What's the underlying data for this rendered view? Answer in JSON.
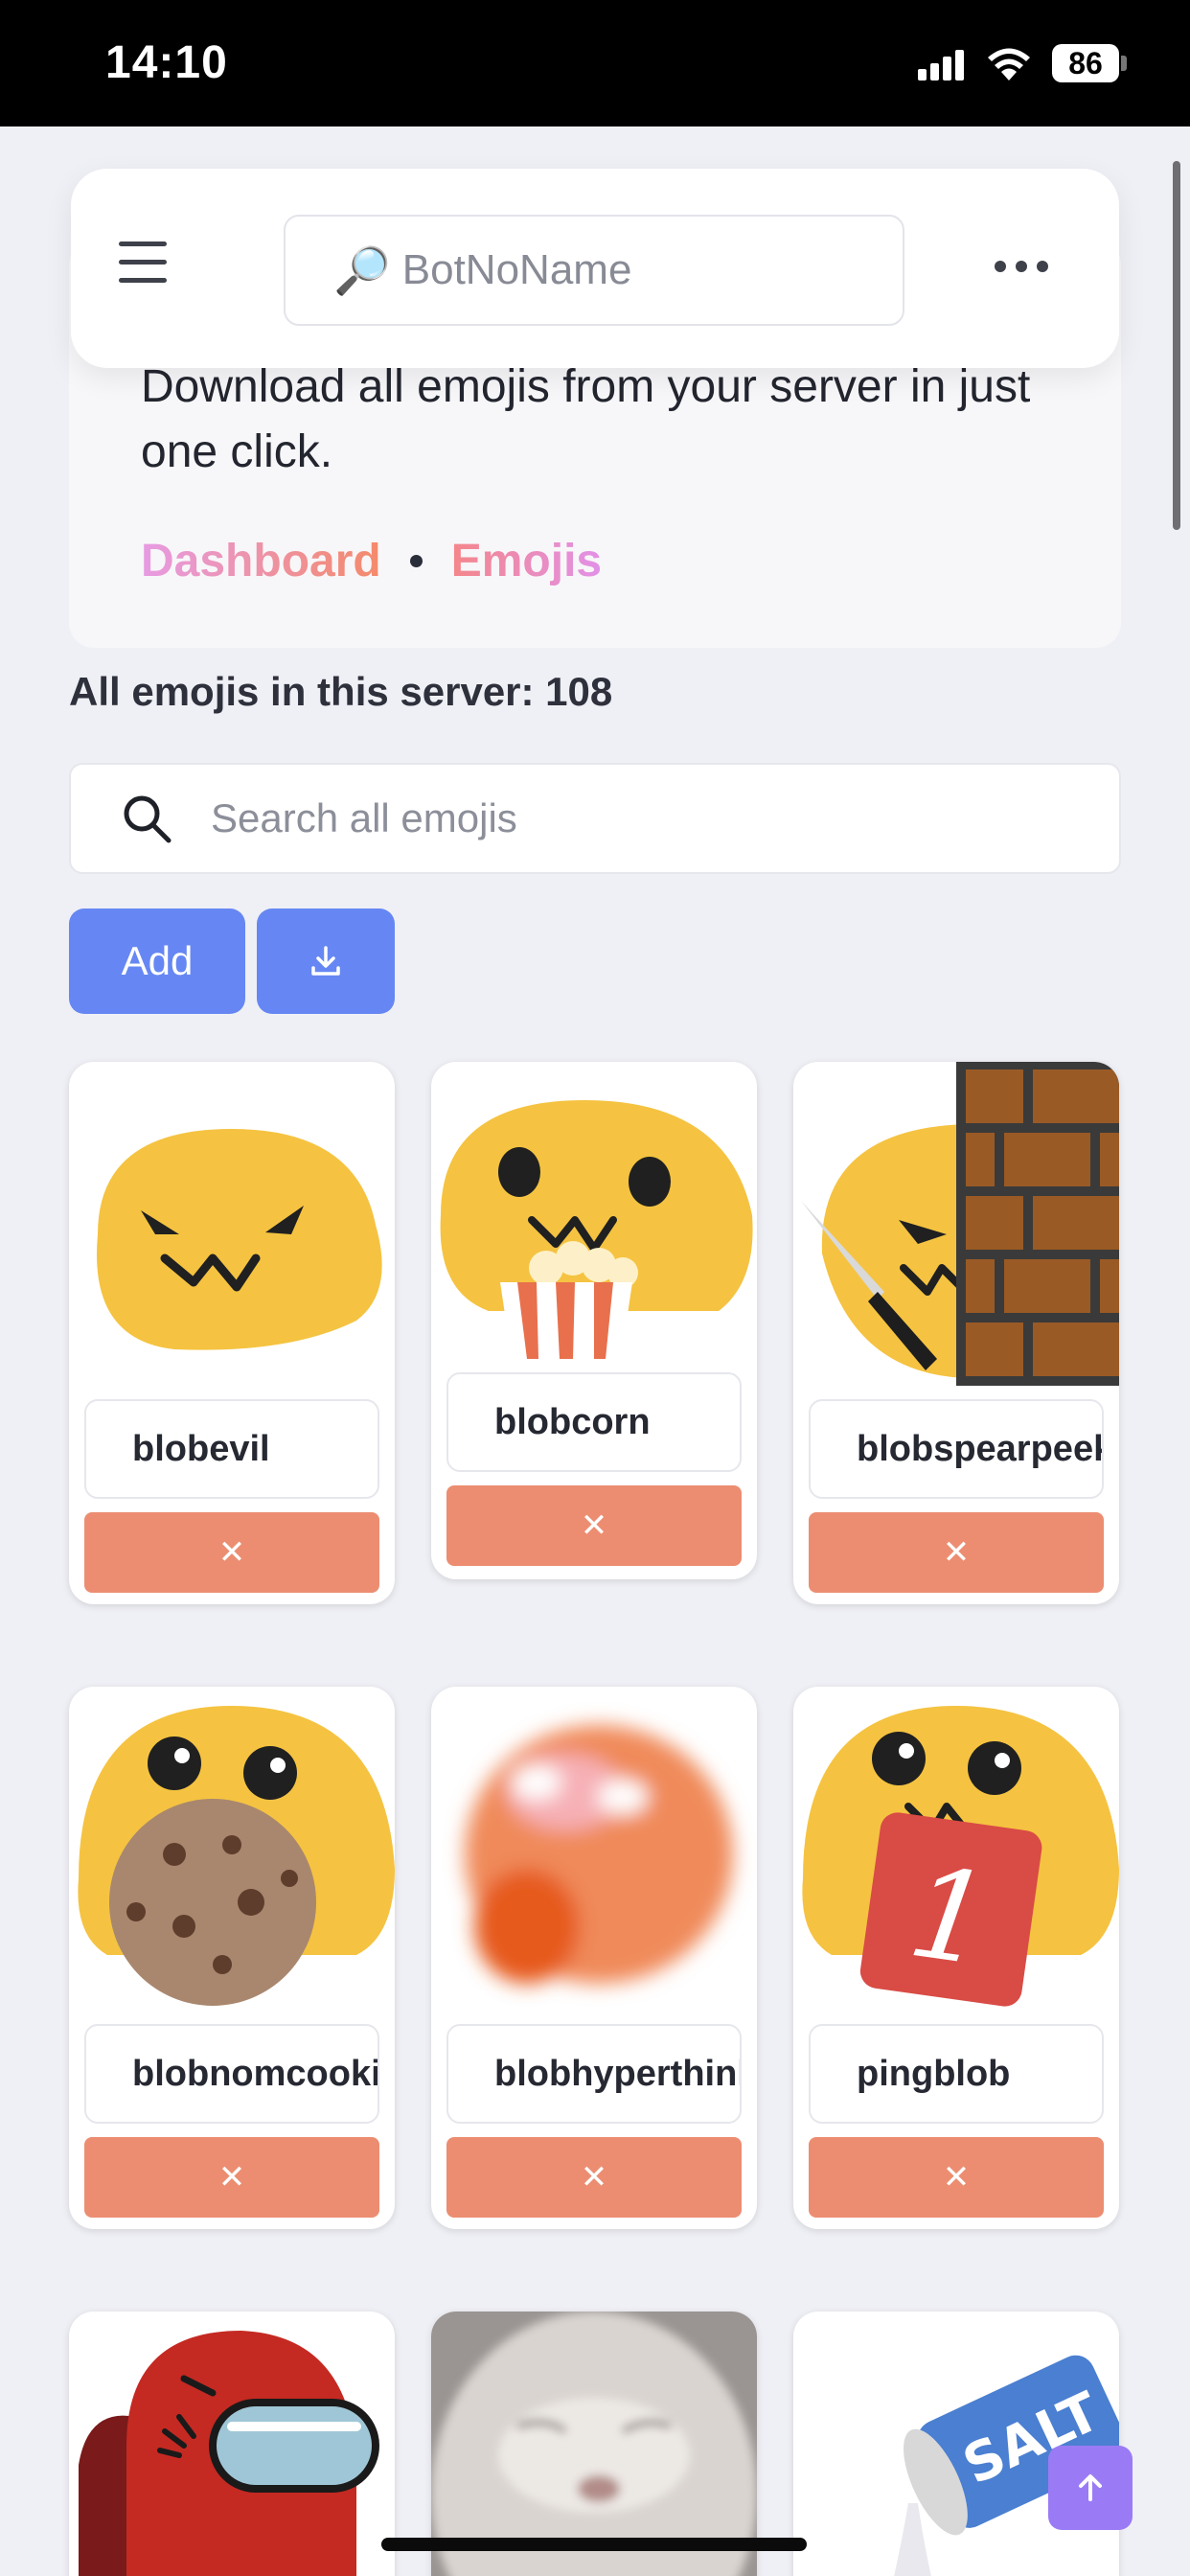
{
  "status_bar": {
    "time": "14:10",
    "battery": "86"
  },
  "header": {
    "search_placeholder": "BotNoName",
    "search_icon": "magnifier-emoji"
  },
  "hero": {
    "description": "Download all emojis from your server in just one click.",
    "breadcrumb": {
      "first": "Dashboard",
      "second": "Emojis"
    }
  },
  "emoji_count_text": "All emojis in this server: 108",
  "search": {
    "placeholder": "Search all emojis"
  },
  "actions": {
    "add_label": "Add",
    "download_icon": "download-icon"
  },
  "delete_label": "✕",
  "emojis": [
    {
      "name": "blobevil"
    },
    {
      "name": "blobcorn"
    },
    {
      "name": "blobspearpeek"
    },
    {
      "name": "blobnomcookie"
    },
    {
      "name": "blobhyperthink"
    },
    {
      "name": "pingblob"
    },
    {
      "name": ""
    },
    {
      "name": ""
    },
    {
      "name": ""
    }
  ],
  "colors": {
    "accent_blue": "#6687f3",
    "delete_orange": "#ec8d71",
    "scroll_top_purple": "#9a7bf5",
    "blob_yellow": "#f5c341"
  }
}
